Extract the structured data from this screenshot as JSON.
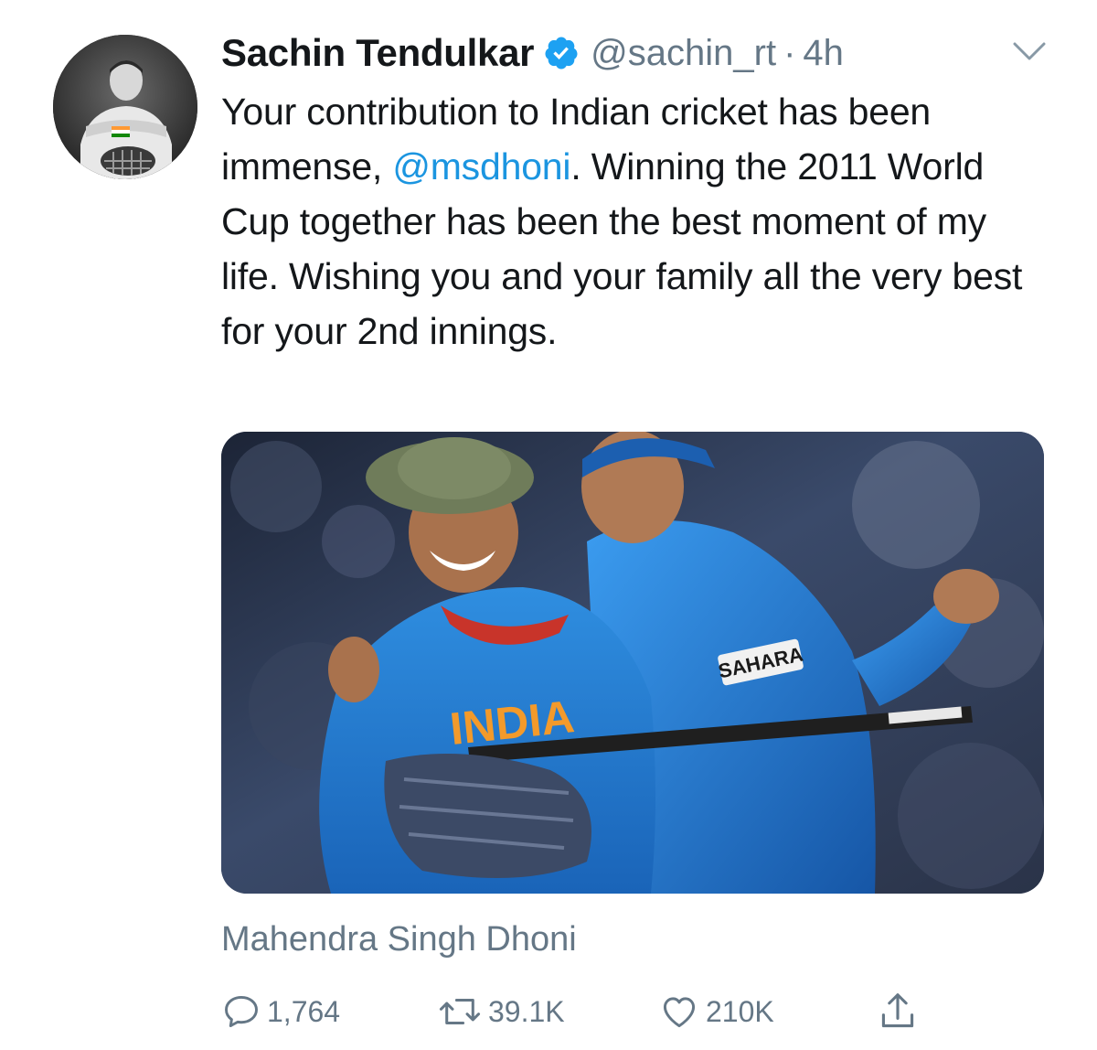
{
  "tweet": {
    "author": {
      "name": "Sachin Tendulkar",
      "handle": "@sachin_rt",
      "separator": "·",
      "time": "4h",
      "verified": true
    },
    "text": {
      "part1": "Your contribution to Indian cricket has been immense, ",
      "mention": "@msdhoni",
      "part2": ". Winning the 2011 World Cup together has been the best moment of my life. Wishing you and your family all the very best for your 2nd innings."
    },
    "media": {
      "jersey_text": "INDIA",
      "sponsor_text": "SAHARA"
    },
    "caption": "Mahendra Singh Dhoni",
    "actions": {
      "reply_count": "1,764",
      "retweet_count": "39.1K",
      "like_count": "210K"
    },
    "icons": {
      "verified": "verified-badge-icon",
      "menu": "chevron-down-icon",
      "reply": "reply-icon",
      "retweet": "retweet-icon",
      "like": "heart-icon",
      "share": "share-icon"
    },
    "colors": {
      "link": "#1b95e0",
      "secondary_text": "#657786",
      "primary_text": "#14171a",
      "verified": "#1da1f2"
    }
  }
}
